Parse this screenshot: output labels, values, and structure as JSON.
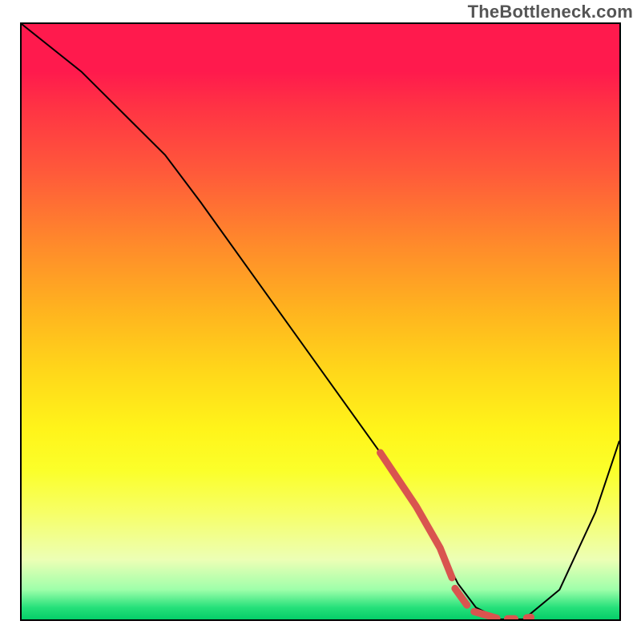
{
  "attribution": "TheBottleneck.com",
  "chart_data": {
    "type": "line",
    "title": "",
    "xlabel": "",
    "ylabel": "",
    "xlim": [
      0,
      100
    ],
    "ylim": [
      0,
      100
    ],
    "gradient_stops": [
      {
        "pos": 0,
        "color": "#ff1a4d"
      },
      {
        "pos": 8,
        "color": "#ff1a4d"
      },
      {
        "pos": 14,
        "color": "#ff3344"
      },
      {
        "pos": 25,
        "color": "#ff5a3a"
      },
      {
        "pos": 37,
        "color": "#ff8a2b"
      },
      {
        "pos": 48,
        "color": "#ffb31f"
      },
      {
        "pos": 58,
        "color": "#ffd61a"
      },
      {
        "pos": 68,
        "color": "#fff41a"
      },
      {
        "pos": 75,
        "color": "#fbff2a"
      },
      {
        "pos": 82,
        "color": "#f7ff66"
      },
      {
        "pos": 90,
        "color": "#ecffb5"
      },
      {
        "pos": 95,
        "color": "#9effaa"
      },
      {
        "pos": 98,
        "color": "#26e07a"
      },
      {
        "pos": 100,
        "color": "#05ce69"
      }
    ],
    "series": [
      {
        "name": "bottleneck-curve",
        "color": "#000000",
        "x": [
          0,
          10,
          18,
          24,
          30,
          40,
          50,
          60,
          66,
          70,
          73,
          76,
          80,
          84,
          90,
          96,
          100
        ],
        "y": [
          100,
          92,
          84,
          78,
          70,
          56,
          42,
          28,
          19,
          12,
          6,
          2,
          0,
          0,
          5,
          18,
          30
        ]
      }
    ],
    "highlight": {
      "name": "dotted-highlight",
      "color": "#d9544f",
      "stroke_width": 9,
      "segments": [
        {
          "x": [
            60,
            66,
            70,
            72
          ],
          "y": [
            28,
            19,
            12,
            7
          ]
        },
        {
          "x": [
            72.5,
            74.5
          ],
          "y": [
            5.2,
            2.4
          ]
        },
        {
          "x": [
            75.7,
            79.5
          ],
          "y": [
            1.3,
            0.2
          ]
        },
        {
          "x": [
            81.3,
            82.5
          ],
          "y": [
            0.1,
            0.1
          ]
        },
        {
          "x": [
            84.5,
            85.2
          ],
          "y": [
            0.25,
            0.35
          ]
        }
      ]
    }
  }
}
